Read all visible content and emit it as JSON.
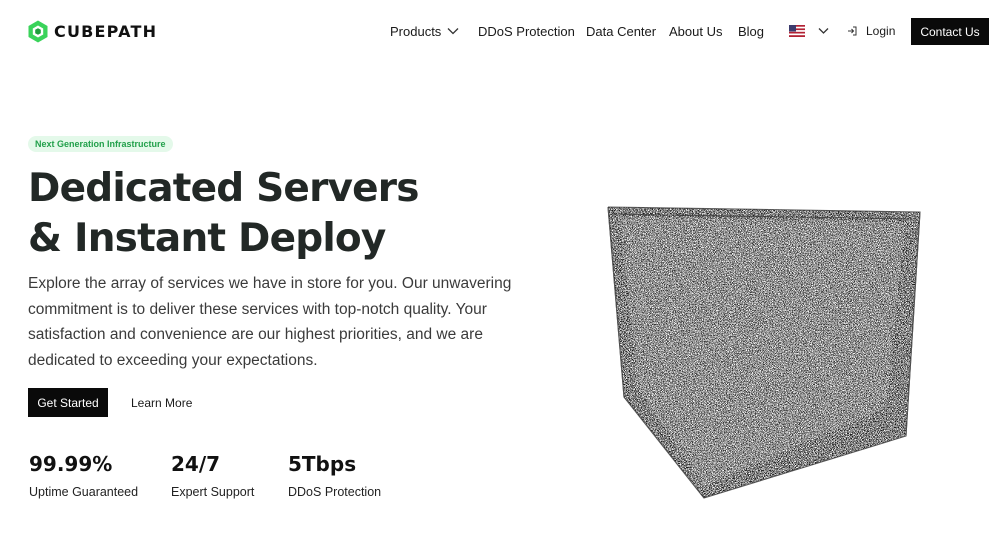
{
  "brand": {
    "name": "CUBEPATH",
    "accent": "#3ad35a",
    "accent_dark": "#1f9e3c"
  },
  "nav": {
    "items": [
      {
        "label": "Products",
        "has_dropdown": true
      },
      {
        "label": "DDoS Protection"
      },
      {
        "label": "Data Center"
      },
      {
        "label": "About Us"
      },
      {
        "label": "Blog"
      }
    ],
    "language_icon": "us-flag-icon",
    "login_label": "Login",
    "contact_label": "Contact Us"
  },
  "hero": {
    "badge": "Next Generation Infrastructure",
    "headline_line1": "Dedicated Servers",
    "headline_line2": "& Instant Deploy",
    "description": "Explore the array of services we have in store for you. Our unwavering commitment is to deliver these services with top-notch quality. Your satisfaction and convenience are our highest priorities, and we are dedicated to exceeding your expectations.",
    "primary_cta": "Get Started",
    "secondary_cta": "Learn More",
    "stats": [
      {
        "value": "99.99%",
        "label": "Uptime Guaranteed"
      },
      {
        "value": "24/7",
        "label": "Expert Support"
      },
      {
        "value": "5Tbps",
        "label": "DDoS Protection"
      }
    ]
  },
  "colors": {
    "button_bg": "#0a0a0a",
    "badge_bg": "#e4f9ea",
    "badge_text": "#22a04b",
    "headline": "#222826"
  }
}
